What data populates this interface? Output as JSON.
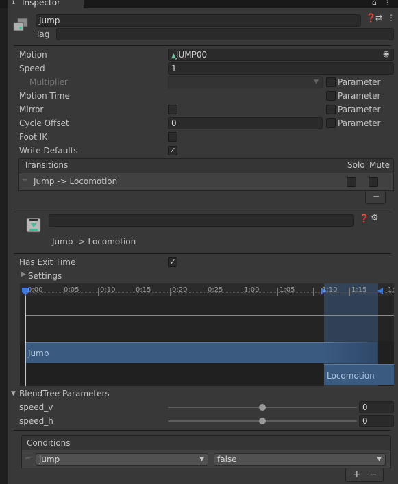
{
  "tab": {
    "title": "Inspector"
  },
  "header": {
    "name": "Jump",
    "tag_label": "Tag",
    "tag_value": ""
  },
  "state": {
    "motion_label": "Motion",
    "motion_value": "JUMP00",
    "speed_label": "Speed",
    "speed_value": "1",
    "multiplier_label": "Multiplier",
    "motion_time_label": "Motion Time",
    "mirror_label": "Mirror",
    "cycle_offset_label": "Cycle Offset",
    "cycle_offset_value": "0",
    "foot_ik_label": "Foot IK",
    "write_defaults_label": "Write Defaults",
    "parameter_label": "Parameter",
    "write_defaults_checked": "✓"
  },
  "transitions": {
    "header": "Transitions",
    "solo_label": "Solo",
    "mute_label": "Mute",
    "rows": [
      {
        "label": "Jump -> Locomotion"
      }
    ],
    "remove_label": "−"
  },
  "transition": {
    "name_value": "",
    "title": "Jump -> Locomotion",
    "has_exit_time_label": "Has Exit Time",
    "has_exit_time_checked": "✓",
    "settings_label": "Settings"
  },
  "timeline": {
    "ticks": [
      "0:00",
      "0:05",
      "0:10",
      "0:15",
      "0:20",
      "0:25",
      "1:00",
      "1:05",
      "1:10",
      "1:15",
      "1:"
    ],
    "source_clip": "Jump",
    "dest_clip": "Locomotion"
  },
  "blend_params": {
    "header": "BlendTree Parameters",
    "items": [
      {
        "name": "speed_v",
        "value": "0",
        "level": 0.5
      },
      {
        "name": "speed_h",
        "value": "0",
        "level": 0.5
      }
    ]
  },
  "conditions": {
    "header": "Conditions",
    "rows": [
      {
        "param": "jump",
        "mode": "false"
      }
    ],
    "add_label": "+",
    "remove_label": "−"
  },
  "colors": {
    "panel": "#383838",
    "clip_blue": "#3a5a80",
    "accent_blue": "#3d7bd8"
  }
}
